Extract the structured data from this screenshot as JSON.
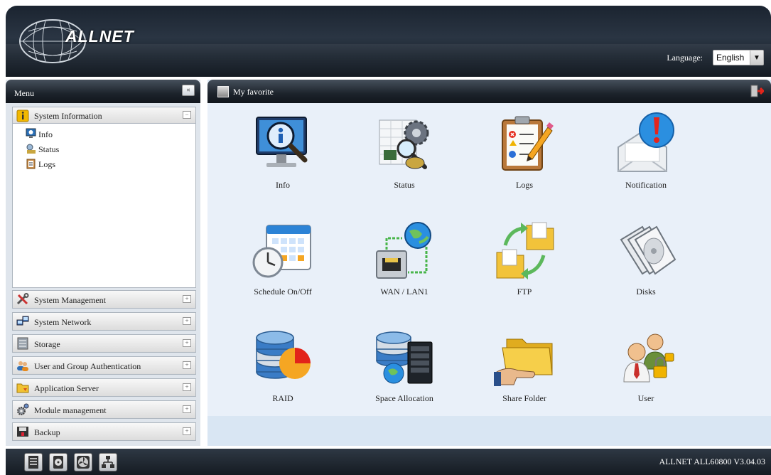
{
  "header": {
    "brand": "ALLNET",
    "language_label": "Language:",
    "language_value": "English"
  },
  "menu": {
    "title": "Menu",
    "collapse_glyph": "«",
    "expanded_section": {
      "label": "System Information",
      "toggle": "−",
      "icon": "info-icon",
      "items": [
        {
          "label": "Info",
          "icon": "monitor-info-icon"
        },
        {
          "label": "Status",
          "icon": "status-icon"
        },
        {
          "label": "Logs",
          "icon": "logs-icon"
        }
      ]
    },
    "sections": [
      {
        "label": "System Management",
        "icon": "tools-icon",
        "toggle": "+"
      },
      {
        "label": "System Network",
        "icon": "network-icon",
        "toggle": "+"
      },
      {
        "label": "Storage",
        "icon": "storage-icon",
        "toggle": "+"
      },
      {
        "label": "User and Group Authentication",
        "icon": "users-icon",
        "toggle": "+"
      },
      {
        "label": "Application Server",
        "icon": "folder-icon",
        "toggle": "+"
      },
      {
        "label": "Module management",
        "icon": "gears-icon",
        "toggle": "+"
      },
      {
        "label": "Backup",
        "icon": "backup-icon",
        "toggle": "+"
      }
    ]
  },
  "favorites": {
    "title": "My favorite",
    "tiles": [
      {
        "label": "Info",
        "icon": "monitor-info-icon"
      },
      {
        "label": "Status",
        "icon": "status-magnifier-icon"
      },
      {
        "label": "Logs",
        "icon": "clipboard-logs-icon"
      },
      {
        "label": "Notification",
        "icon": "envelope-alert-icon"
      },
      {
        "label": "Schedule On/Off",
        "icon": "calendar-clock-icon"
      },
      {
        "label": "WAN / LAN1",
        "icon": "ethernet-globe-icon"
      },
      {
        "label": "FTP",
        "icon": "folder-sync-icon"
      },
      {
        "label": "Disks",
        "icon": "disks-icon"
      },
      {
        "label": "RAID",
        "icon": "database-pie-icon"
      },
      {
        "label": "Space Allocation",
        "icon": "database-server-icon"
      },
      {
        "label": "Share Folder",
        "icon": "share-folder-icon"
      },
      {
        "label": "User",
        "icon": "user-lock-icon"
      }
    ]
  },
  "footer": {
    "buttons": [
      "server-icon",
      "disk-icon",
      "fan-icon",
      "network-tree-icon"
    ],
    "version": "ALLNET ALL60800 V3.04.03"
  },
  "colors": {
    "header_dark": "#1b2430",
    "panel_bg": "#dfe5ec",
    "content_bg": "#e9f0f9"
  }
}
